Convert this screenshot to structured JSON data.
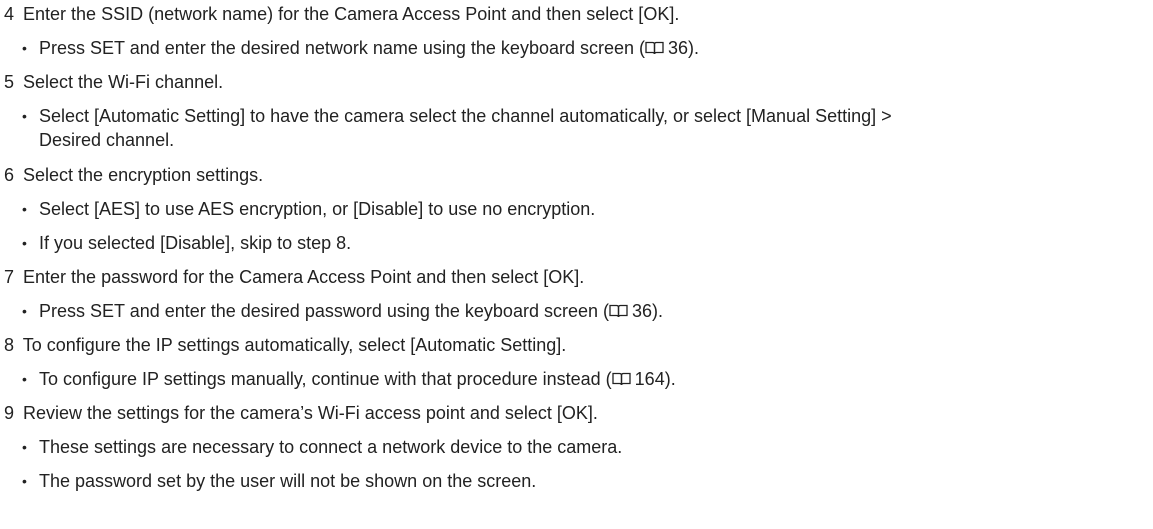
{
  "steps": [
    {
      "num": "4",
      "text": "Enter the SSID (network name) for the Camera Access Point and then select [OK].",
      "bullets": [
        {
          "pre": "Press SET and enter the desired network name using the keyboard screen (",
          "page": "36",
          "post": ")."
        }
      ]
    },
    {
      "num": "5",
      "text": "Select the Wi-Fi channel.",
      "bullets": [
        {
          "line1": "Select [Automatic Setting] to have the camera select the channel automatically, or select [Manual Setting] >",
          "line2": "Desired channel."
        }
      ]
    },
    {
      "num": "6",
      "text": "Select the encryption settings.",
      "bullets": [
        {
          "text": "Select [AES] to use AES encryption, or [Disable] to use no encryption."
        },
        {
          "text": "If you selected [Disable], skip to step 8."
        }
      ]
    },
    {
      "num": "7",
      "text": "Enter the password for the Camera Access Point and then select [OK].",
      "bullets": [
        {
          "pre": "Press SET and enter the desired password using the keyboard screen (",
          "page": "36",
          "post": ")."
        }
      ]
    },
    {
      "num": "8",
      "text": "To configure the IP settings automatically, select [Automatic Setting].",
      "bullets": [
        {
          "pre": "To configure IP settings manually, continue with that procedure instead (",
          "page": "164",
          "post": ")."
        }
      ]
    },
    {
      "num": "9",
      "text": "Review the settings for the camera’s Wi-Fi access point and select [OK].",
      "bullets": [
        {
          "text": "These settings are necessary to connect a network device to the camera."
        },
        {
          "text": "The password set by the user will not be shown on the screen."
        }
      ]
    }
  ],
  "icons": {
    "page_reference": "book-icon",
    "bullet": "bullet-dot"
  },
  "bullet_char": "•"
}
